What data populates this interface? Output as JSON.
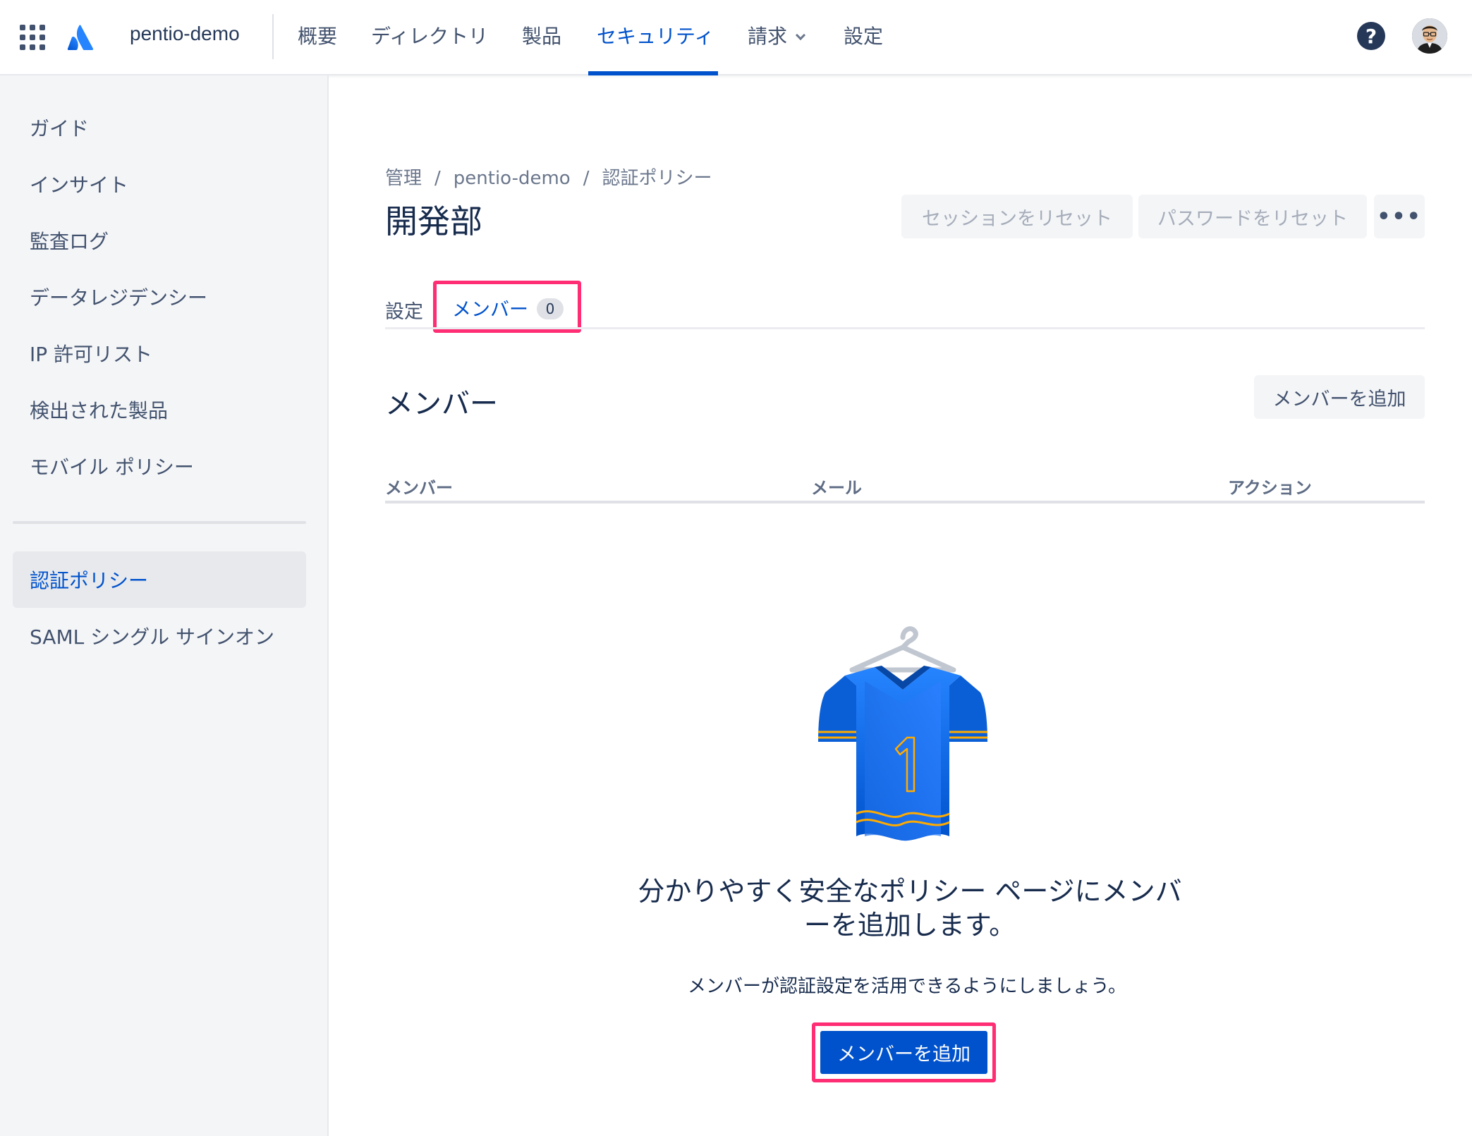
{
  "topnav": {
    "org": "pentio-demo",
    "items": [
      {
        "label": "概要"
      },
      {
        "label": "ディレクトリ"
      },
      {
        "label": "製品"
      },
      {
        "label": "セキュリティ",
        "active": true
      },
      {
        "label": "請求",
        "has_dropdown": true
      },
      {
        "label": "設定"
      }
    ],
    "help_icon": "?"
  },
  "sidebar": {
    "items": [
      {
        "label": "ガイド"
      },
      {
        "label": "インサイト"
      },
      {
        "label": "監査ログ"
      },
      {
        "label": "データレジデンシー"
      },
      {
        "label": "IP 許可リスト"
      },
      {
        "label": "検出された製品"
      },
      {
        "label": "モバイル ポリシー"
      },
      {
        "label": "認証ポリシー",
        "active": true
      },
      {
        "label": "SAML シングル サインオン"
      }
    ]
  },
  "breadcrumb": {
    "items": [
      "管理",
      "pentio-demo",
      "認証ポリシー"
    ],
    "separator": "/"
  },
  "page": {
    "title": "開発部",
    "actions": {
      "reset_session": "セッションをリセット",
      "reset_password": "パスワードをリセット",
      "more": "•••"
    }
  },
  "tabs": {
    "settings": "設定",
    "members": "メンバー",
    "members_count": "0"
  },
  "members_section": {
    "title": "メンバー",
    "add_button": "メンバーを追加",
    "columns": [
      "メンバー",
      "メール",
      "アクション"
    ]
  },
  "empty_state": {
    "title": "分かりやすく安全なポリシー ページにメンバーを追加します。",
    "description": "メンバーが認証設定を活用できるようにしましょう。",
    "cta": "メンバーを追加",
    "jersey_number": "1"
  },
  "colors": {
    "accent": "#0052cc",
    "highlight": "#ff2d73",
    "sidebar_bg": "#f4f5f7"
  }
}
